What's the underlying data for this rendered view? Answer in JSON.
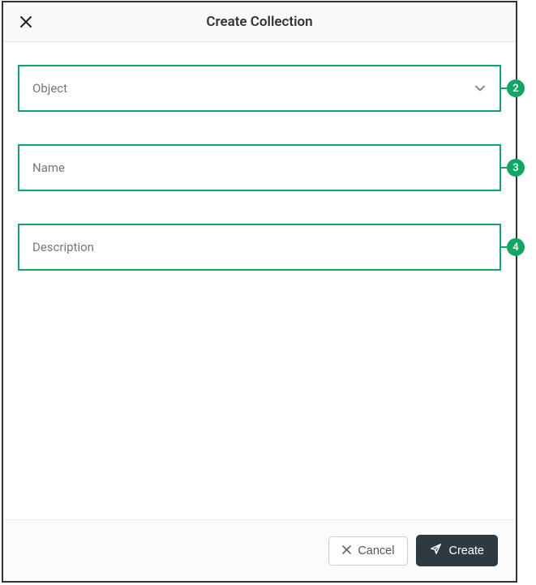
{
  "modal": {
    "title": "Create Collection",
    "fields": {
      "object": {
        "placeholder": "Object",
        "callout": "2"
      },
      "name": {
        "placeholder": "Name",
        "callout": "3"
      },
      "description": {
        "placeholder": "Description",
        "callout": "4"
      }
    },
    "footer": {
      "cancel_label": "Cancel",
      "create_label": "Create"
    }
  }
}
